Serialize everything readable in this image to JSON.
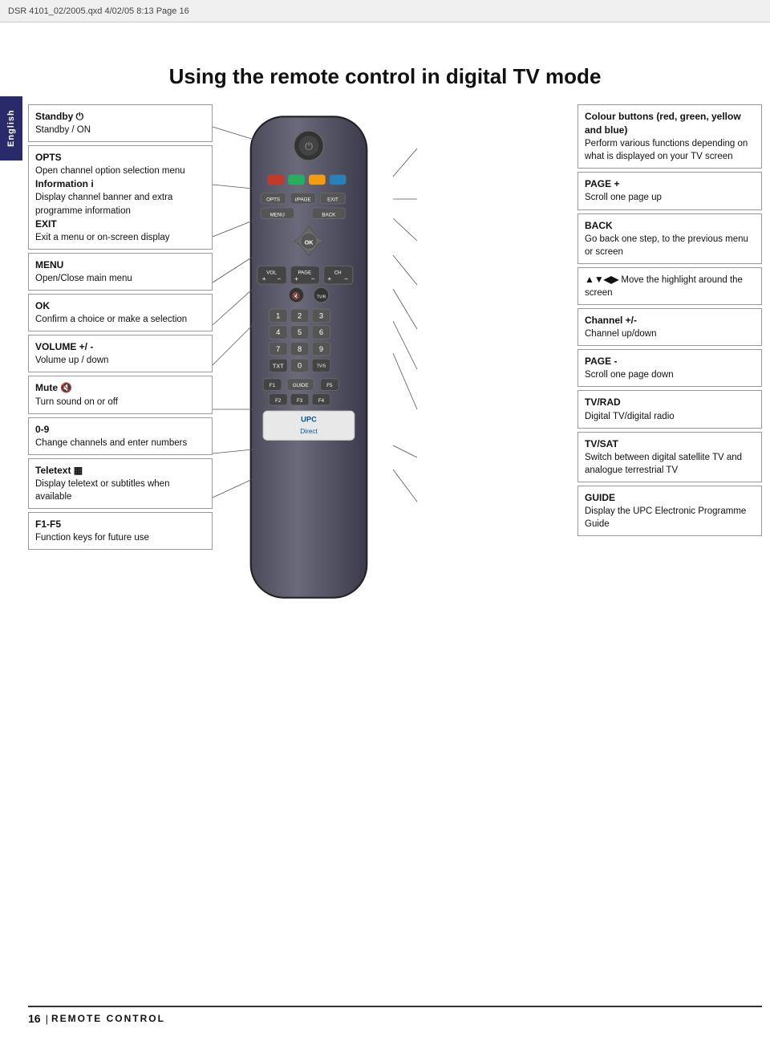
{
  "header": {
    "text": "DSR 4101_02/2005.qxd   4/02/05   8:13   Page 16"
  },
  "page": {
    "title": "Using the remote control in digital TV mode",
    "language_tab": "English",
    "footer_page": "16",
    "footer_section": "REMOTE CONTROL"
  },
  "left_boxes": [
    {
      "id": "standby",
      "label": "Standby ⏻",
      "text": "Standby / ON"
    },
    {
      "id": "opts-exit",
      "label": "OPTS",
      "text": "Open channel option selection menu",
      "label2": "Information i",
      "text2": "Display channel banner and extra programme information",
      "label3": "EXIT",
      "text3": "Exit a menu or on-screen display"
    },
    {
      "id": "menu",
      "label": "MENU",
      "text": "Open/Close main menu"
    },
    {
      "id": "ok",
      "label": "OK",
      "text": "Confirm a choice or make a selection"
    },
    {
      "id": "volume",
      "label": "VOLUME +/ -",
      "text": "Volume up / down"
    },
    {
      "id": "mute",
      "label": "Mute 🔇",
      "text": "Turn sound on or off"
    },
    {
      "id": "0-9",
      "label": "0-9",
      "text": "Change channels and enter numbers"
    },
    {
      "id": "teletext",
      "label": "Teletext ▦",
      "text": "Display teletext or subtitles when available"
    },
    {
      "id": "f1f5",
      "label": "F1-F5",
      "text": "Function keys for future use"
    }
  ],
  "right_boxes": [
    {
      "id": "colour",
      "label": "Colour buttons (red, green, yellow and blue)",
      "text": "Perform various functions depending on what is displayed on your TV screen"
    },
    {
      "id": "page-plus",
      "label": "PAGE +",
      "text": "Scroll one page up"
    },
    {
      "id": "back",
      "label": "BACK",
      "text": "Go back one step, to the previous menu or screen"
    },
    {
      "id": "arrows",
      "label": "▲▼◀▶",
      "text": "Move the highlight around the screen"
    },
    {
      "id": "channel",
      "label": "Channel +/-",
      "text": "Channel up/down"
    },
    {
      "id": "page-minus",
      "label": "PAGE -",
      "text": "Scroll one page down"
    },
    {
      "id": "tvrad",
      "label": "TV/RAD",
      "text": "Digital TV/digital radio"
    },
    {
      "id": "tvsat",
      "label": "TV/SAT",
      "text": "Switch between digital satellite TV and analogue terrestrial TV"
    },
    {
      "id": "guide",
      "label": "GUIDE",
      "text": "Display the UPC Electronic Programme Guide"
    }
  ]
}
